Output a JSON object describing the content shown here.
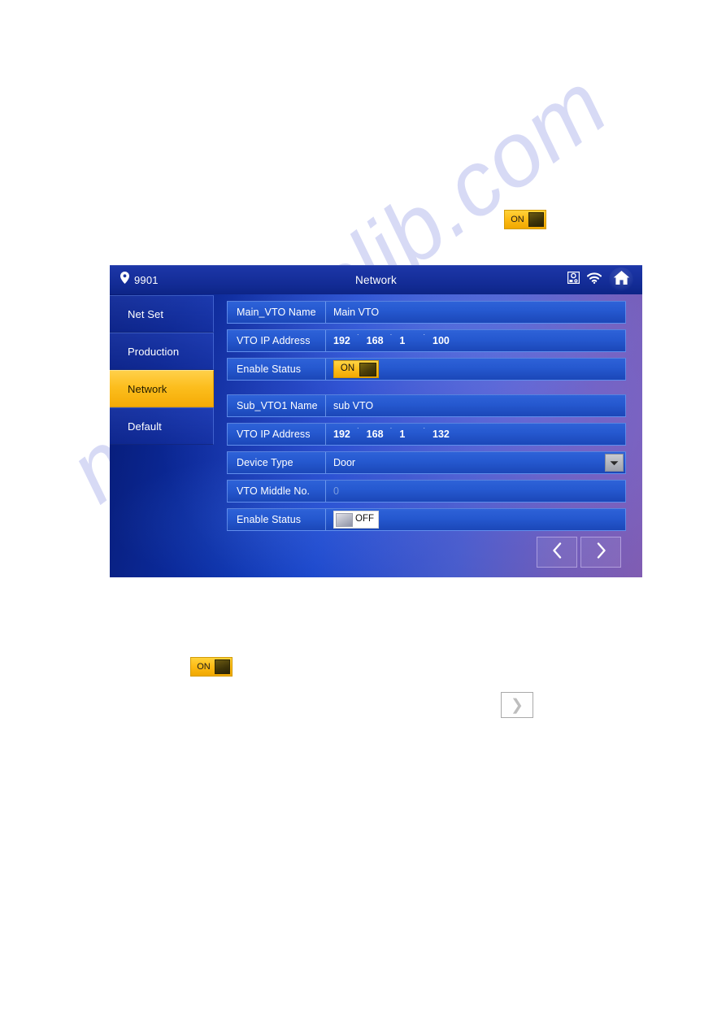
{
  "page": {
    "watermark": "manualslib.com"
  },
  "doc_widgets": {
    "toggle_top": {
      "label": "ON",
      "state": "on"
    },
    "toggle_bottom": {
      "label": "ON",
      "state": "on"
    },
    "next_arrow": {
      "glyph": "❯"
    }
  },
  "device": {
    "titlebar": {
      "room_number": "9901",
      "title": "Network",
      "icons": [
        {
          "name": "monitor-camera-icon"
        },
        {
          "name": "wifi-icon"
        },
        {
          "name": "home-icon"
        }
      ]
    },
    "sidebar": {
      "items": [
        {
          "label": "Net Set",
          "active": false
        },
        {
          "label": "Production",
          "active": false
        },
        {
          "label": "Network",
          "active": true
        },
        {
          "label": "Default",
          "active": false
        }
      ]
    },
    "form": {
      "main_vto": {
        "name": {
          "label": "Main_VTO Name",
          "value": "Main VTO"
        },
        "ip": {
          "label": "VTO IP Address",
          "octets": [
            "192",
            "168",
            "1",
            "100"
          ],
          "separator": "˙"
        },
        "enable": {
          "label": "Enable Status",
          "toggle": "ON",
          "state": "on"
        }
      },
      "sub_vto1": {
        "name": {
          "label": "Sub_VTO1 Name",
          "value": "sub VTO"
        },
        "ip": {
          "label": "VTO IP Address",
          "octets": [
            "192",
            "168",
            "1",
            "132"
          ],
          "separator": "˙"
        },
        "device_type": {
          "label": "Device Type",
          "value": "Door"
        },
        "middle_no": {
          "label": "VTO Middle No.",
          "value": "0"
        },
        "enable": {
          "label": "Enable Status",
          "toggle": "OFF",
          "state": "off"
        }
      }
    },
    "pager": {
      "prev": "‹",
      "next": "›"
    }
  },
  "colors": {
    "accent_orange": "#fcbe1e",
    "titlebar_blue": "#122a92",
    "row_blue": "#2558cf",
    "panel_purple": "#8257a6"
  }
}
